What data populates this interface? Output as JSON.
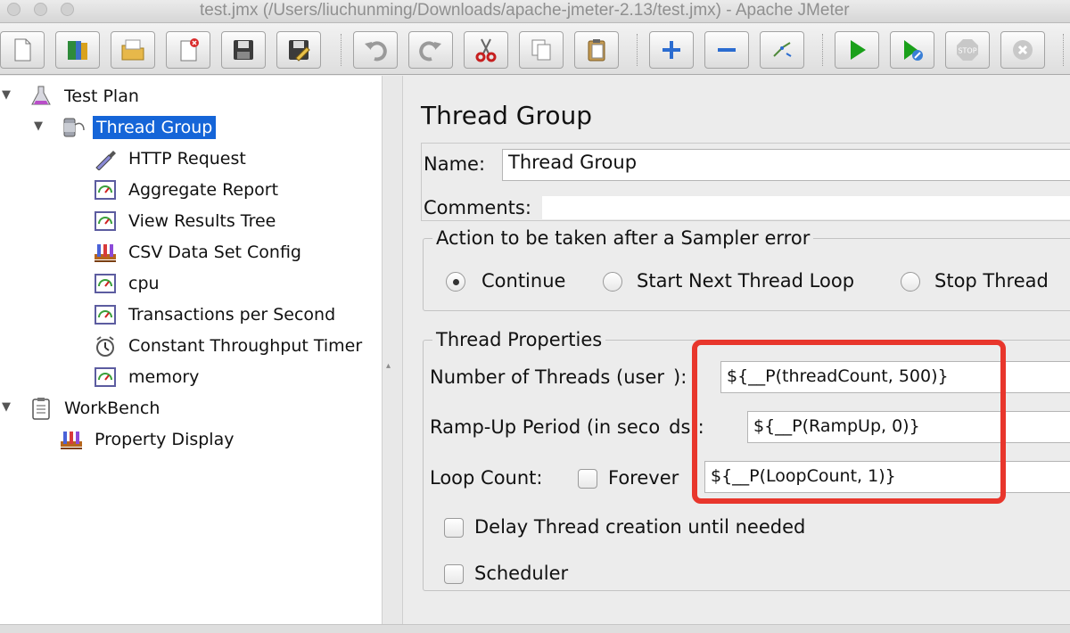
{
  "window": {
    "title": "test.jmx (/Users/liuchunming/Downloads/apache-jmeter-2.13/test.jmx) - Apache JMeter"
  },
  "toolbar": {
    "buttons": [
      "new-icon",
      "templates-icon",
      "open-icon",
      "close-file-icon",
      "save-icon",
      "save-as-icon",
      "undo-icon",
      "redo-icon",
      "cut-icon",
      "copy-icon",
      "paste-icon",
      "expand-icon",
      "collapse-icon",
      "toggle-icon",
      "start-icon",
      "start-no-pauses-icon",
      "stop-icon",
      "shutdown-icon"
    ]
  },
  "tree": {
    "test_plan": "Test Plan",
    "thread_group": "Thread Group",
    "items": [
      "HTTP Request",
      "Aggregate Report",
      "View Results Tree",
      "CSV Data Set Config",
      "cpu",
      "Transactions per Second",
      "Constant Throughput Timer",
      "memory"
    ],
    "workbench": "WorkBench",
    "property_display": "Property Display"
  },
  "panel": {
    "heading": "Thread Group",
    "name_label": "Name:",
    "name_value": "Thread Group",
    "comments_label": "Comments:",
    "comments_value": "",
    "error_action": {
      "title": "Action to be taken after a Sampler error",
      "options": [
        "Continue",
        "Start Next Thread Loop",
        "Stop Thread"
      ],
      "selected": "Continue"
    },
    "thread_props": {
      "title": "Thread Properties",
      "threads_label": "Number of Threads (user",
      "threads_label_tail": "):",
      "threads_value": "${__P(threadCount, 500)}",
      "rampup_label": "Ramp-Up Period (in seco",
      "rampup_label_tail": "ds):",
      "rampup_value": "${__P(RampUp, 0)}",
      "loop_label": "Loop Count:",
      "forever_label": "Forever",
      "loop_value": "${__P(LoopCount, 1)}",
      "delay_label": "Delay Thread creation until needed",
      "scheduler_label": "Scheduler"
    }
  },
  "colors": {
    "selection": "#1565d8",
    "highlight": "#e8362c",
    "start_green": "#1aa01a"
  }
}
